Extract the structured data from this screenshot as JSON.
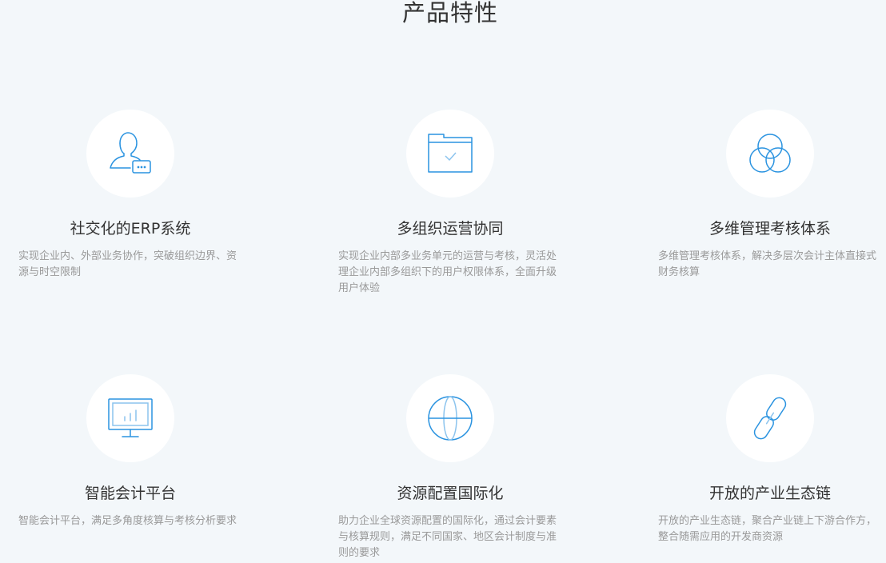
{
  "section": {
    "title": "产品特性"
  },
  "colors": {
    "accent": "#2a93e0",
    "background": "#f3f7fa",
    "title": "#333333",
    "description": "#999999"
  },
  "features": [
    {
      "icon": "user-chat-icon",
      "title": "社交化的ERP系统",
      "description": "实现企业内、外部业务协作，突破组织边界、资源与时空限制"
    },
    {
      "icon": "folder-check-icon",
      "title": "多组织运营协同",
      "description": "实现企业内部多业务单元的运营与考核，灵活处理企业内部多组织下的用户权限体系，全面升级用户体验"
    },
    {
      "icon": "overlapping-circles-icon",
      "title": "多维管理考核体系",
      "description": "多维管理考核体系，解决多层次会计主体直接式财务核算"
    },
    {
      "icon": "monitor-chart-icon",
      "title": "智能会计平台",
      "description": "智能会计平台，满足多角度核算与考核分析要求"
    },
    {
      "icon": "globe-icon",
      "title": "资源配置国际化",
      "description": "助力企业全球资源配置的国际化，通过会计要素与核算规则，满足不同国家、地区会计制度与准则的要求"
    },
    {
      "icon": "link-icon",
      "title": "开放的产业生态链",
      "description": "开放的产业生态链，聚合产业链上下游合作方，整合随需应用的开发商资源"
    }
  ]
}
